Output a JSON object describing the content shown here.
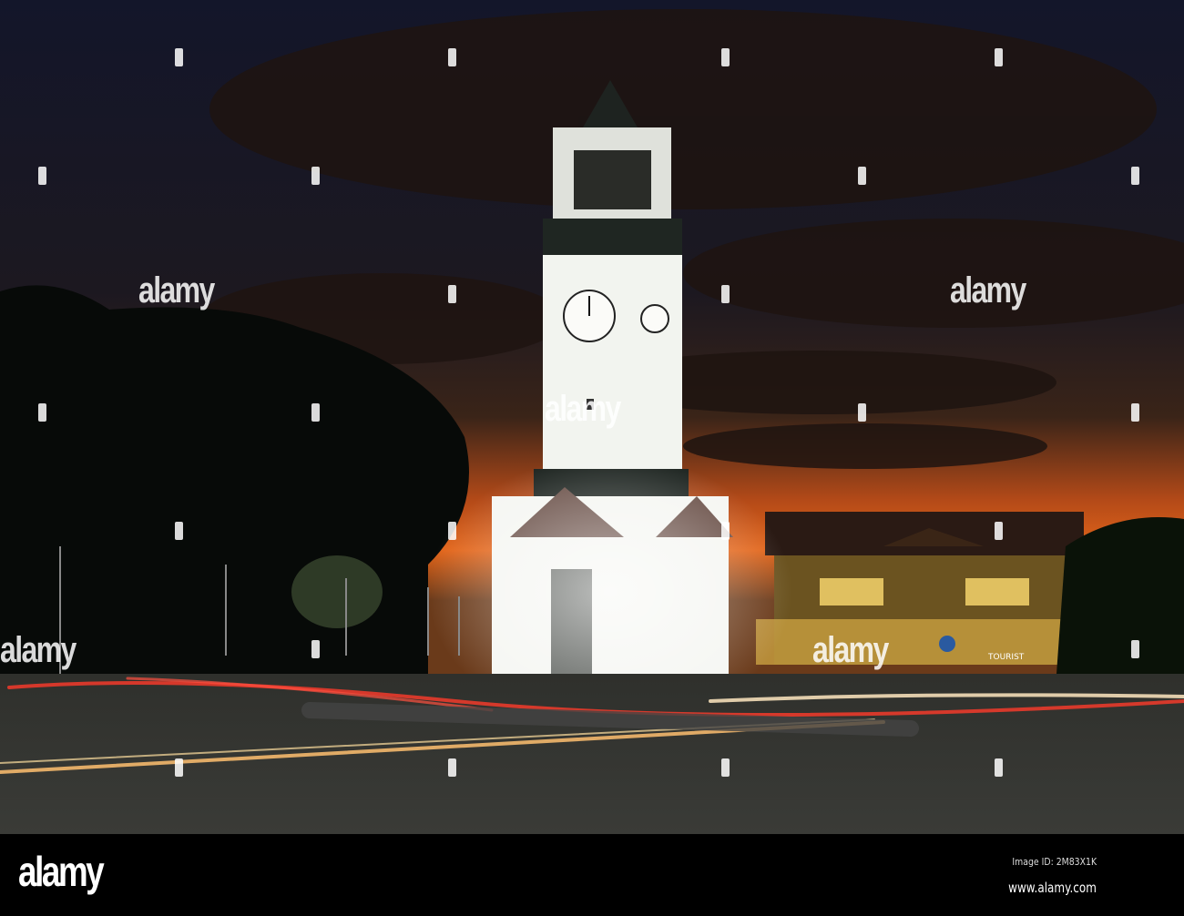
{
  "watermark": {
    "text": "alamy"
  },
  "footer": {
    "logo": "alamy",
    "image_id": "Image ID: 2M83X1K",
    "url": "www.alamy.com"
  },
  "scene": {
    "subject": "clock tower at dusk",
    "sign_text": "TOURIST",
    "colors": {
      "sky_top": "#15172a",
      "horizon": "#e2651a",
      "tower": "#f2f4ef",
      "road": "#2a2c2a",
      "trail_red": "#ff3b2a",
      "trail_amber": "#ffc070"
    }
  }
}
